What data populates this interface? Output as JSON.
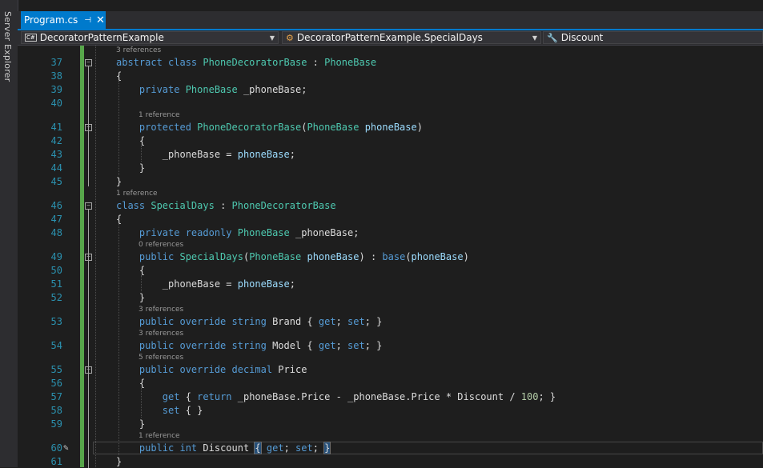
{
  "sidebar": {
    "server_explorer": "Server Explorer"
  },
  "tab": {
    "label": "Program.cs",
    "pin": "⊣",
    "close": "✕"
  },
  "nav": {
    "project": "DecoratorPatternExample",
    "type": "DecoratorPatternExample.SpecialDays",
    "member": "Discount"
  },
  "editor": {
    "lines": [
      {
        "n": "37",
        "lens": "3 references",
        "tokens": [
          [
            "kw",
            "abstract class "
          ],
          [
            "ty",
            "PhoneDecoratorBase"
          ],
          [
            "pl",
            " : "
          ],
          [
            "ty",
            "PhoneBase"
          ]
        ]
      },
      {
        "n": "38",
        "tokens": [
          [
            "pl",
            "{"
          ]
        ]
      },
      {
        "n": "39",
        "tokens": [
          [
            "pl",
            "    "
          ],
          [
            "kw",
            "private "
          ],
          [
            "ty",
            "PhoneBase"
          ],
          [
            "pl",
            " _phoneBase;"
          ]
        ]
      },
      {
        "n": "40",
        "tokens": []
      },
      {
        "n": "41",
        "lens": "1 reference",
        "tokens": [
          [
            "pl",
            "    "
          ],
          [
            "kw",
            "protected "
          ],
          [
            "ty",
            "PhoneDecoratorBase"
          ],
          [
            "pl",
            "("
          ],
          [
            "ty",
            "PhoneBase"
          ],
          [
            "pl",
            " "
          ],
          [
            "pa",
            "phoneBase"
          ],
          [
            "pl",
            ")"
          ]
        ]
      },
      {
        "n": "42",
        "tokens": [
          [
            "pl",
            "    {"
          ]
        ]
      },
      {
        "n": "43",
        "tokens": [
          [
            "pl",
            "        _phoneBase = "
          ],
          [
            "pa",
            "phoneBase"
          ],
          [
            "pl",
            ";"
          ]
        ]
      },
      {
        "n": "44",
        "tokens": [
          [
            "pl",
            "    }"
          ]
        ]
      },
      {
        "n": "45",
        "tokens": [
          [
            "pl",
            "}"
          ]
        ]
      },
      {
        "n": "46",
        "lens": "1 reference",
        "tokens": [
          [
            "kw",
            "class "
          ],
          [
            "ty",
            "SpecialDays"
          ],
          [
            "pl",
            " : "
          ],
          [
            "ty",
            "PhoneDecoratorBase"
          ]
        ]
      },
      {
        "n": "47",
        "tokens": [
          [
            "pl",
            "{"
          ]
        ]
      },
      {
        "n": "48",
        "tokens": [
          [
            "pl",
            "    "
          ],
          [
            "kw",
            "private readonly "
          ],
          [
            "ty",
            "PhoneBase"
          ],
          [
            "pl",
            " _phoneBase;"
          ]
        ]
      },
      {
        "n": "49",
        "lens": "0 references",
        "tokens": [
          [
            "pl",
            "    "
          ],
          [
            "kw",
            "public "
          ],
          [
            "ty",
            "SpecialDays"
          ],
          [
            "pl",
            "("
          ],
          [
            "ty",
            "PhoneBase"
          ],
          [
            "pl",
            " "
          ],
          [
            "pa",
            "phoneBase"
          ],
          [
            "pl",
            ") : "
          ],
          [
            "kw",
            "base"
          ],
          [
            "pl",
            "("
          ],
          [
            "pa",
            "phoneBase"
          ],
          [
            "pl",
            ")"
          ]
        ]
      },
      {
        "n": "50",
        "tokens": [
          [
            "pl",
            "    {"
          ]
        ]
      },
      {
        "n": "51",
        "tokens": [
          [
            "pl",
            "        _phoneBase = "
          ],
          [
            "pa",
            "phoneBase"
          ],
          [
            "pl",
            ";"
          ]
        ]
      },
      {
        "n": "52",
        "tokens": [
          [
            "pl",
            "    }"
          ]
        ]
      },
      {
        "n": "53",
        "lens": "3 references",
        "tokens": [
          [
            "pl",
            "    "
          ],
          [
            "kw",
            "public override string "
          ],
          [
            "pl",
            "Brand { "
          ],
          [
            "kw",
            "get"
          ],
          [
            "pl",
            "; "
          ],
          [
            "kw",
            "set"
          ],
          [
            "pl",
            "; }"
          ]
        ]
      },
      {
        "n": "54",
        "lens": "3 references",
        "tokens": [
          [
            "pl",
            "    "
          ],
          [
            "kw",
            "public override string "
          ],
          [
            "pl",
            "Model { "
          ],
          [
            "kw",
            "get"
          ],
          [
            "pl",
            "; "
          ],
          [
            "kw",
            "set"
          ],
          [
            "pl",
            "; }"
          ]
        ]
      },
      {
        "n": "55",
        "lens": "5 references",
        "tokens": [
          [
            "pl",
            "    "
          ],
          [
            "kw",
            "public override decimal "
          ],
          [
            "pl",
            "Price"
          ]
        ]
      },
      {
        "n": "56",
        "tokens": [
          [
            "pl",
            "    {"
          ]
        ]
      },
      {
        "n": "57",
        "tokens": [
          [
            "pl",
            "        "
          ],
          [
            "kw",
            "get"
          ],
          [
            "pl",
            " { "
          ],
          [
            "kw",
            "return"
          ],
          [
            "pl",
            " _phoneBase.Price - _phoneBase.Price * Discount / "
          ],
          [
            "nm",
            "100"
          ],
          [
            "pl",
            "; }"
          ]
        ]
      },
      {
        "n": "58",
        "tokens": [
          [
            "pl",
            "        "
          ],
          [
            "kw",
            "set"
          ],
          [
            "pl",
            " { }"
          ]
        ]
      },
      {
        "n": "59",
        "tokens": [
          [
            "pl",
            "    }"
          ]
        ]
      },
      {
        "n": "60",
        "lens": "1 reference",
        "tokens": [
          [
            "pl",
            "    "
          ],
          [
            "kw",
            "public int "
          ],
          [
            "pl",
            "Discount "
          ],
          [
            "hl",
            "{"
          ],
          [
            "pl",
            " "
          ],
          [
            "kw",
            "get"
          ],
          [
            "pl",
            "; "
          ],
          [
            "kw",
            "set"
          ],
          [
            "pl",
            "; "
          ],
          [
            "hl",
            "}"
          ]
        ]
      },
      {
        "n": "61",
        "tokens": [
          [
            "pl",
            "}"
          ]
        ]
      }
    ]
  }
}
